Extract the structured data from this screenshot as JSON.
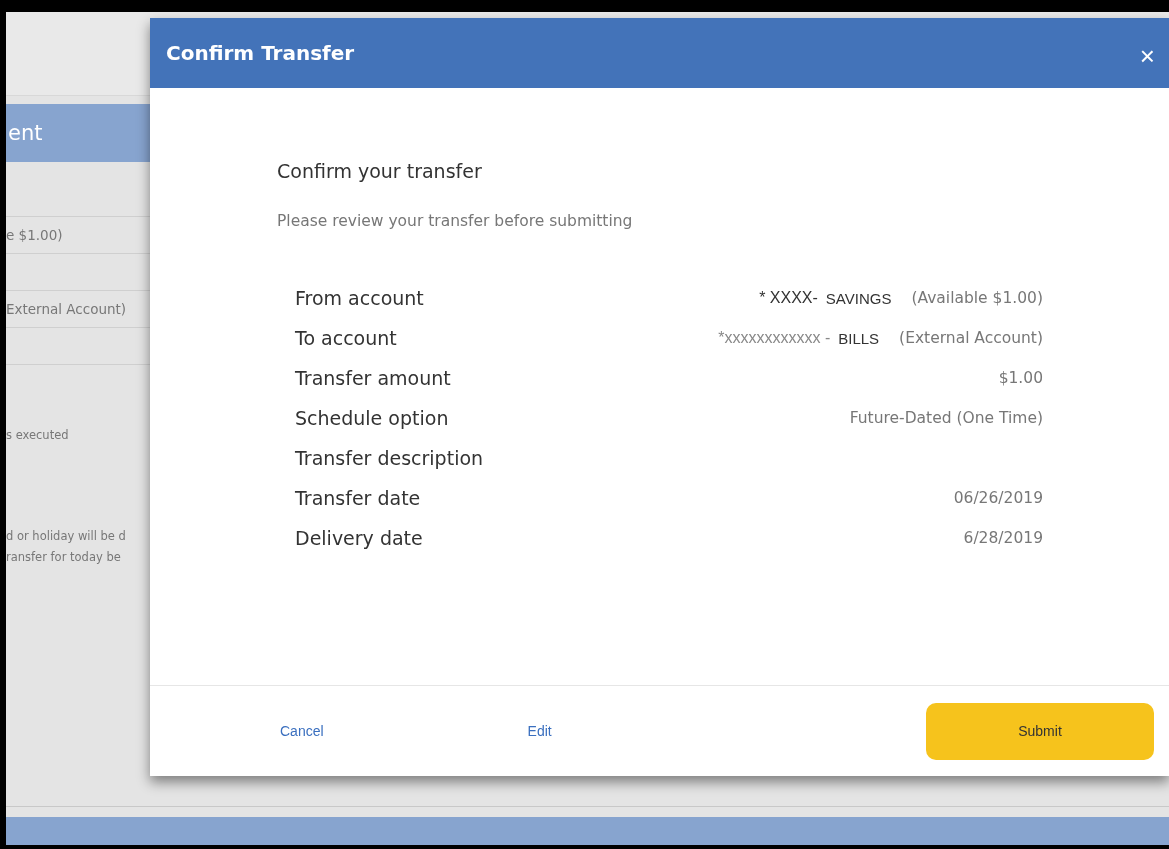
{
  "background": {
    "heading": "ent",
    "rows": [
      {
        "text": ""
      },
      {
        "text": "e $1.00)"
      },
      {
        "text": ""
      },
      {
        "text": "External Account)"
      },
      {
        "text": ""
      }
    ],
    "notes": [
      "s executed",
      "d or holiday will be d",
      "ransfer for today be"
    ]
  },
  "dialog": {
    "title": "Confirm Transfer",
    "close": "×",
    "heading": "Confirm your transfer",
    "subtitle": "Please review your transfer before submitting",
    "details": [
      {
        "label": "From account",
        "parts": [
          {
            "kind": "masked-dark",
            "text": "* XXXX-"
          },
          {
            "kind": "name",
            "text": "SAVINGS"
          },
          {
            "kind": "note",
            "text": "(Available $1.00)"
          }
        ]
      },
      {
        "label": "To account",
        "parts": [
          {
            "kind": "masked",
            "text": "*xxxxxxxxxxxx -"
          },
          {
            "kind": "name",
            "text": "BILLS"
          },
          {
            "kind": "note",
            "text": "(External Account)"
          }
        ]
      },
      {
        "label": "Transfer amount",
        "parts": [
          {
            "kind": "note",
            "text": "$1.00"
          }
        ]
      },
      {
        "label": "Schedule option",
        "parts": [
          {
            "kind": "note",
            "text": "Future-Dated (One Time)"
          }
        ]
      },
      {
        "label": "Transfer description"
      },
      {
        "label": "Transfer date",
        "parts": [
          {
            "kind": "note",
            "text": "06/26/2019"
          }
        ]
      },
      {
        "label": "Delivery date",
        "parts": [
          {
            "kind": "note",
            "text": "6/28/2019"
          }
        ]
      }
    ],
    "actions": [
      {
        "kind": "link",
        "label": "Cancel"
      },
      {
        "kind": "link",
        "label": "Edit"
      },
      {
        "kind": "primary",
        "label": "Submit"
      }
    ]
  }
}
